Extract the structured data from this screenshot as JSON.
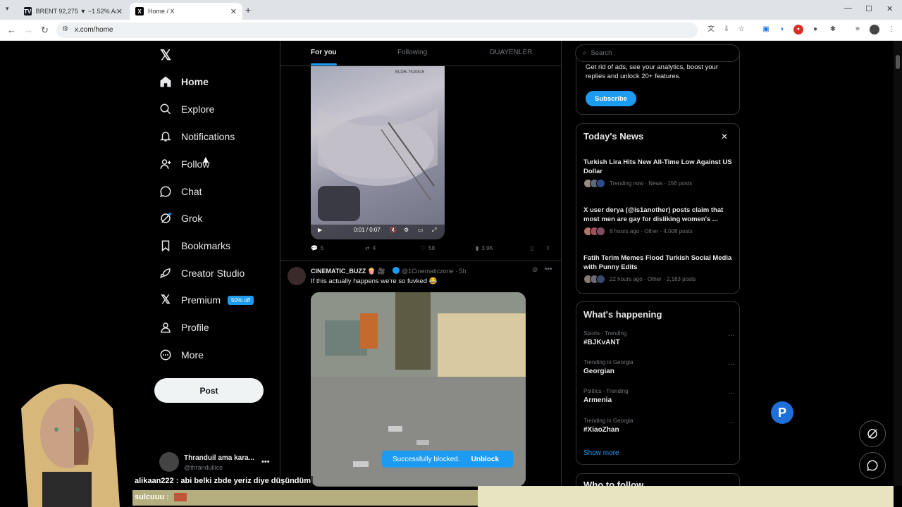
{
  "browser": {
    "tabs": [
      {
        "title": "BRENT 92,275 ▼ −1.52% Adsız",
        "favicon": "tv"
      },
      {
        "title": "Home / X",
        "favicon": "X"
      }
    ],
    "url": "x.com/home"
  },
  "sidebar": {
    "items": [
      {
        "label": "Home",
        "icon": "home-icon"
      },
      {
        "label": "Explore",
        "icon": "search-icon"
      },
      {
        "label": "Notifications",
        "icon": "bell-icon"
      },
      {
        "label": "Follow",
        "icon": "add-person-icon"
      },
      {
        "label": "Chat",
        "icon": "chat-bubble-icon"
      },
      {
        "label": "Grok",
        "icon": "grok-icon"
      },
      {
        "label": "Bookmarks",
        "icon": "bookmark-icon"
      },
      {
        "label": "Creator Studio",
        "icon": "rocket-icon"
      },
      {
        "label": "Premium",
        "icon": "x-logo-icon",
        "badge": "50% off"
      },
      {
        "label": "Profile",
        "icon": "person-icon"
      },
      {
        "label": "More",
        "icon": "more-circle-icon"
      }
    ],
    "post_label": "Post",
    "account": {
      "name": "Thranduil ama kara...",
      "handle": "@thrandullice"
    }
  },
  "timeline": {
    "tabs": [
      "For you",
      "Following",
      "DUAYENLER"
    ],
    "video1": {
      "time": "0:01 / 0:07",
      "watermark": "ELDR-7520815"
    },
    "tweet1_actions": {
      "replies": "5",
      "reposts": "4",
      "likes": "58",
      "views": "3.9K"
    },
    "tweet2": {
      "name": "CINEMATIC_BUZZ 🍿 🎥",
      "handle": "@1Cinematiczone · 5h",
      "text": "If this actually happens we're so fuvked 😂"
    }
  },
  "toast": {
    "message": "Successfully blocked.",
    "action": "Unblock"
  },
  "right": {
    "search_placeholder": "Search",
    "subscribe": {
      "text": "Get rid of ads, see your analytics, boost your replies and unlock 20+ features.",
      "button": "Subscribe"
    },
    "news": {
      "title": "Today's News",
      "items": [
        {
          "headline": "Turkish Lira Hits New All-Time Low Against US Dollar",
          "meta": "Trending now · News · 156 posts"
        },
        {
          "headline": "X user derya (@is1another) posts claim that most men are gay for disliking women's ...",
          "meta": "8 hours ago · Other · 4,008 posts"
        },
        {
          "headline": "Fatih Terim Memes Flood Turkish Social Media with Punny Edits",
          "meta": "22 hours ago · Other · 2,183 posts"
        }
      ]
    },
    "happening": {
      "title": "What's happening",
      "trends": [
        {
          "category": "Sports · Trending",
          "name": "#BJKvANT"
        },
        {
          "category": "Trending in Georgia",
          "name": "Georgian"
        },
        {
          "category": "Politics · Trending",
          "name": "Armenia"
        },
        {
          "category": "Trending in Georgia",
          "name": "#XiaoZhan"
        }
      ],
      "show_more": "Show more"
    },
    "who_to_follow": "Who to follow"
  },
  "stream_chat": {
    "line1": "alikaan222 : abi belki zbde yeriz diye düşündüm",
    "line2": "sulcuuu :"
  },
  "colors": {
    "accent": "#1d9bf0",
    "background": "#000000",
    "border": "#2f3336",
    "muted": "#71767b"
  }
}
